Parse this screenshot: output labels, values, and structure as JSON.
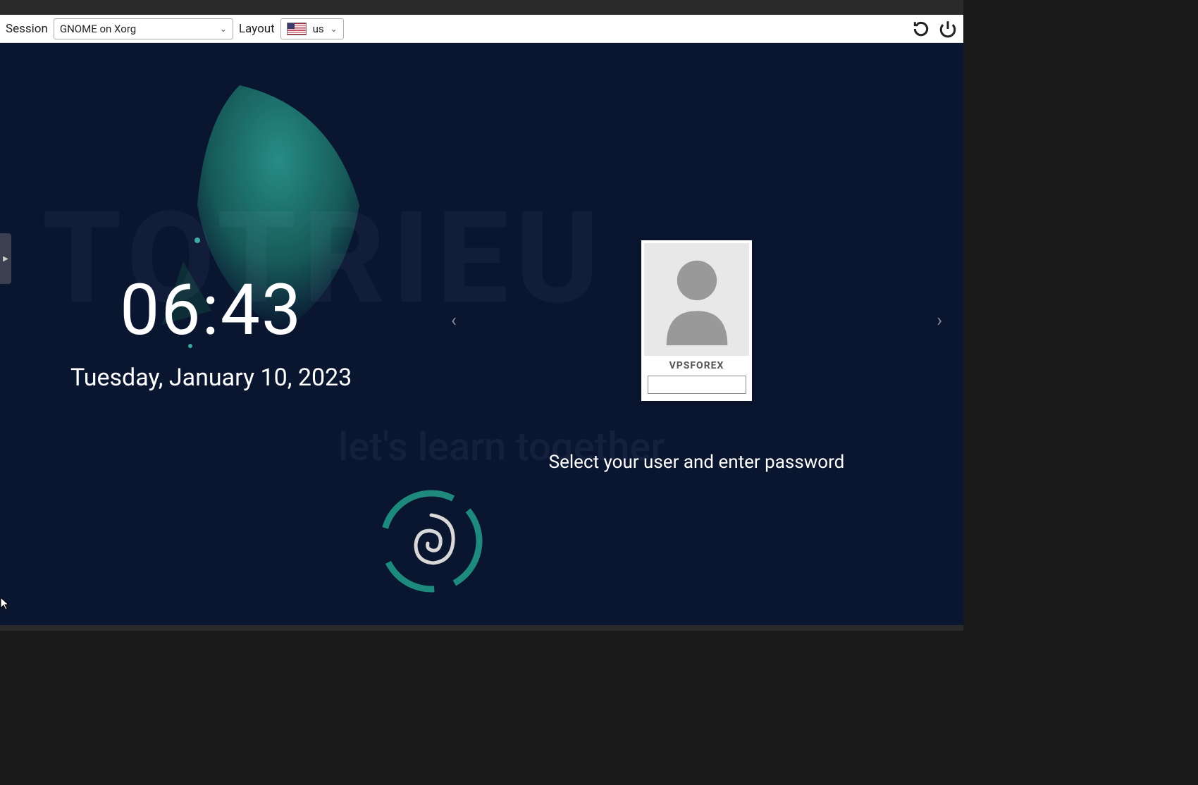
{
  "toolbar": {
    "session_label": "Session",
    "session_value": "GNOME on Xorg",
    "layout_label": "Layout",
    "layout_value": "us"
  },
  "clock": {
    "time": "06:43",
    "date": "Tuesday, January 10, 2023"
  },
  "login": {
    "username": "VPSFOREX",
    "password_value": "",
    "prompt": "Select your user and enter password"
  },
  "watermark": {
    "main": "TOTRIEU",
    "sub": "let's learn together"
  }
}
